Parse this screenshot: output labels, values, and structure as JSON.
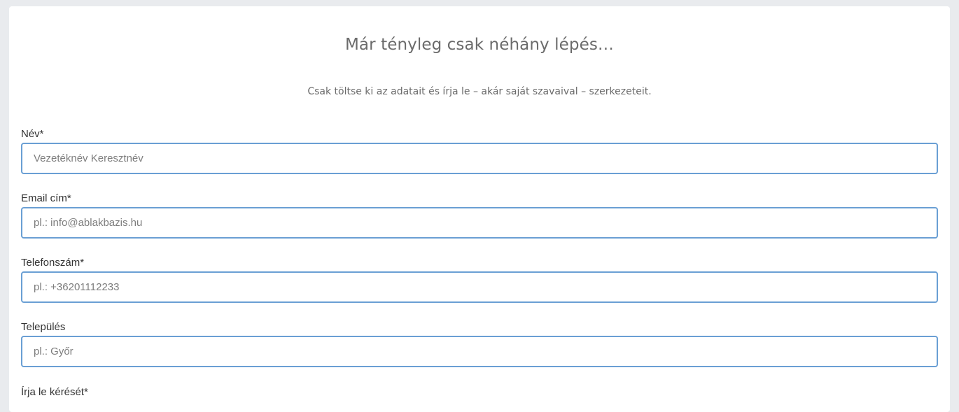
{
  "form": {
    "title": "Már tényleg csak néhány lépés…",
    "subtitle": "Csak töltse ki az adatait és írja le – akár saját szavaival – szerkezeteit.",
    "fields": [
      {
        "label": "Név*",
        "placeholder": "Vezetéknév Keresztnév",
        "value": ""
      },
      {
        "label": "Email cím*",
        "placeholder": "pl.: info@ablakbazis.hu",
        "value": ""
      },
      {
        "label": "Telefonszám*",
        "placeholder": "pl.: +36201112233",
        "value": ""
      },
      {
        "label": "Település",
        "placeholder": "pl.: Győr",
        "value": ""
      },
      {
        "label": "Írja le kérését*"
      }
    ]
  },
  "colors": {
    "background": "#e9ebee",
    "card": "#ffffff",
    "input_border": "#6a9fd4",
    "heading_text": "#6b6b6b"
  }
}
